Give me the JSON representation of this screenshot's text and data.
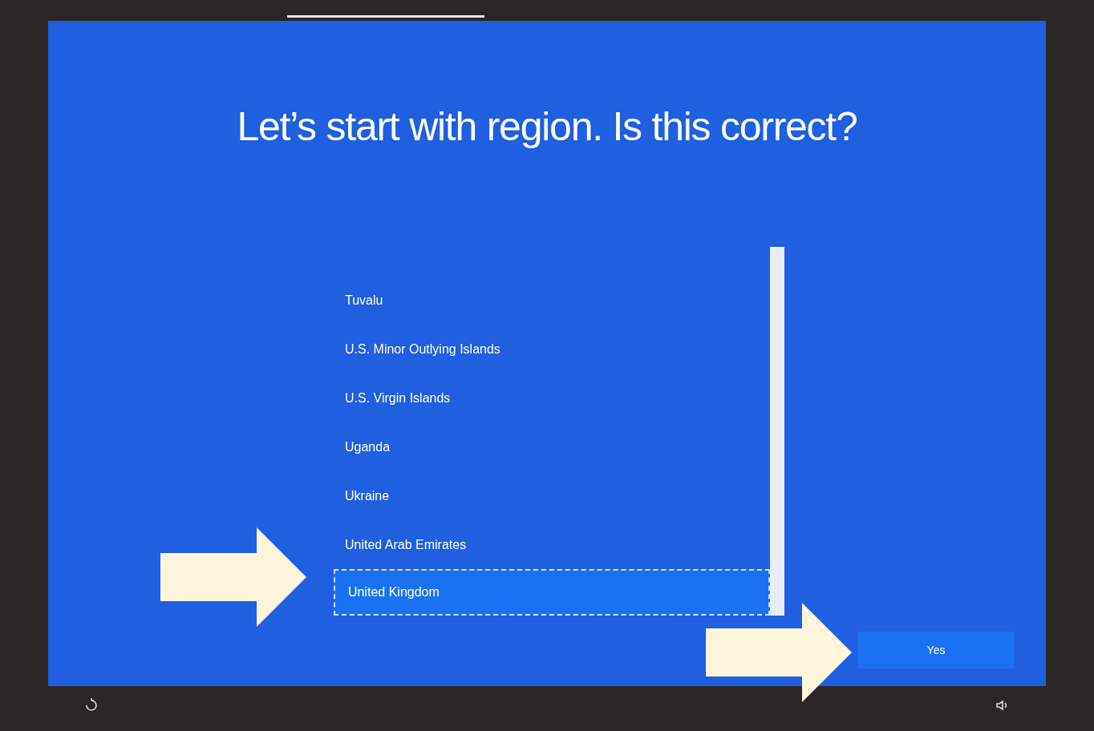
{
  "title": "Let’s start with region. Is this correct?",
  "regions": [
    {
      "label": "Tuvalu",
      "selected": false
    },
    {
      "label": "U.S. Minor Outlying Islands",
      "selected": false
    },
    {
      "label": "U.S. Virgin Islands",
      "selected": false
    },
    {
      "label": "Uganda",
      "selected": false
    },
    {
      "label": "Ukraine",
      "selected": false
    },
    {
      "label": "United Arab Emirates",
      "selected": false
    },
    {
      "label": "United Kingdom",
      "selected": true
    }
  ],
  "buttons": [
    {
      "label": "Yes"
    }
  ]
}
